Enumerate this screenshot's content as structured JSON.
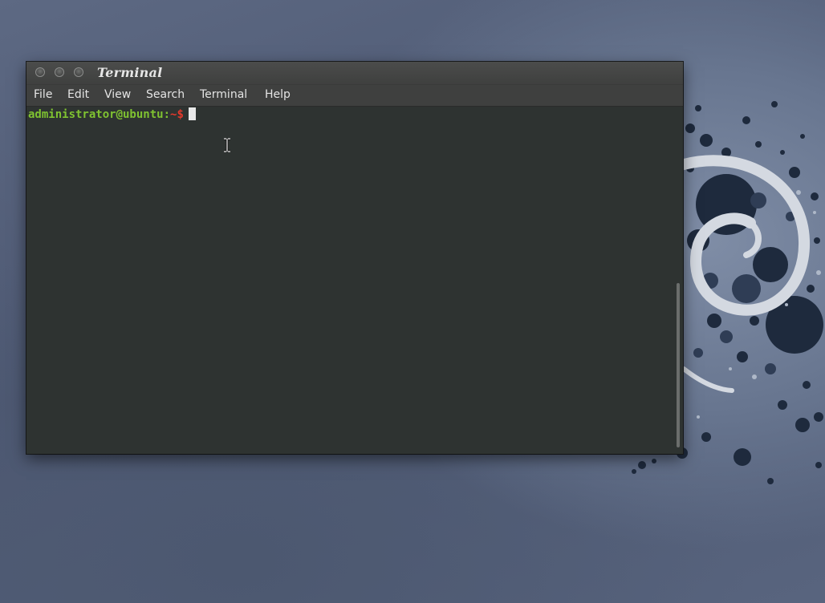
{
  "window": {
    "title": "Terminal",
    "controls": [
      "close",
      "minimize",
      "maximize"
    ]
  },
  "menubar": {
    "items": [
      "File",
      "Edit",
      "View",
      "Search",
      "Terminal",
      "Help"
    ]
  },
  "terminal": {
    "prompt_user_host": "administrator@ubuntu",
    "prompt_separator": ":",
    "prompt_path": "~",
    "prompt_symbol": "$",
    "input": ""
  },
  "colors": {
    "prompt_user": "#7fc231",
    "prompt_path": "#e2392c",
    "terminal_bg": "#2e3331"
  },
  "icons": {
    "mouse_pointer": "text-cursor-ibeam-icon",
    "wallpaper": "debian-swirl-logo"
  }
}
